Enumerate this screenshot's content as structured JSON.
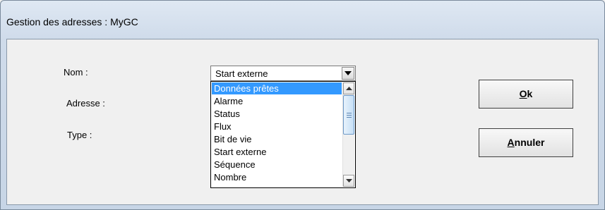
{
  "window": {
    "title": "Gestion des adresses : MyGC"
  },
  "labels": {
    "nom": "Nom :",
    "adresse": "Adresse :",
    "type": "Type :"
  },
  "combo": {
    "value": "Start externe"
  },
  "list": {
    "items": [
      "Données prêtes",
      "Alarme",
      "Status",
      "Flux",
      "Bit de vie",
      "Start externe",
      "Séquence",
      "Nombre"
    ],
    "selected_index": 0
  },
  "buttons": {
    "ok": {
      "accel": "O",
      "rest": "k"
    },
    "cancel": {
      "accel": "A",
      "rest": "nnuler"
    }
  },
  "colors": {
    "selection": "#3399ff"
  }
}
